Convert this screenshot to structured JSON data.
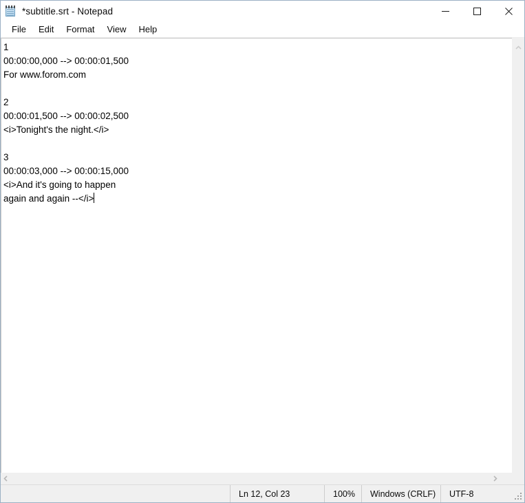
{
  "window": {
    "title": "*subtitle.srt - Notepad",
    "icon": "notepad-icon",
    "controls": {
      "minimize": "minimize-icon",
      "maximize": "maximize-icon",
      "close": "close-icon"
    }
  },
  "menubar": {
    "items": [
      {
        "label": "File"
      },
      {
        "label": "Edit"
      },
      {
        "label": "Format"
      },
      {
        "label": "View"
      },
      {
        "label": "Help"
      }
    ]
  },
  "document": {
    "lines": [
      "1",
      "00:00:00,000 --> 00:00:01,500",
      "For www.forom.com",
      "",
      "2",
      "00:00:01,500 --> 00:00:02,500",
      "<i>Tonight's the night.</i>",
      "",
      "3",
      "00:00:03,000 --> 00:00:15,000",
      "<i>And it's going to happen",
      "again and again --</i>"
    ],
    "caret_line_index": 11
  },
  "scrollbars": {
    "vertical": {
      "up_arrow": "chevron-up-icon"
    },
    "horizontal": {
      "left_arrow": "chevron-left-icon",
      "right_arrow": "chevron-right-icon"
    }
  },
  "statusbar": {
    "cursor_position": "Ln 12, Col 23",
    "zoom": "100%",
    "line_ending": "Windows (CRLF)",
    "encoding": "UTF-8",
    "grip": "resize-grip-icon"
  },
  "colors": {
    "window_border": "#9bb0c4",
    "status_bg": "#f0f0f0",
    "scroll_bg": "#f0f0f0",
    "text": "#000000"
  }
}
